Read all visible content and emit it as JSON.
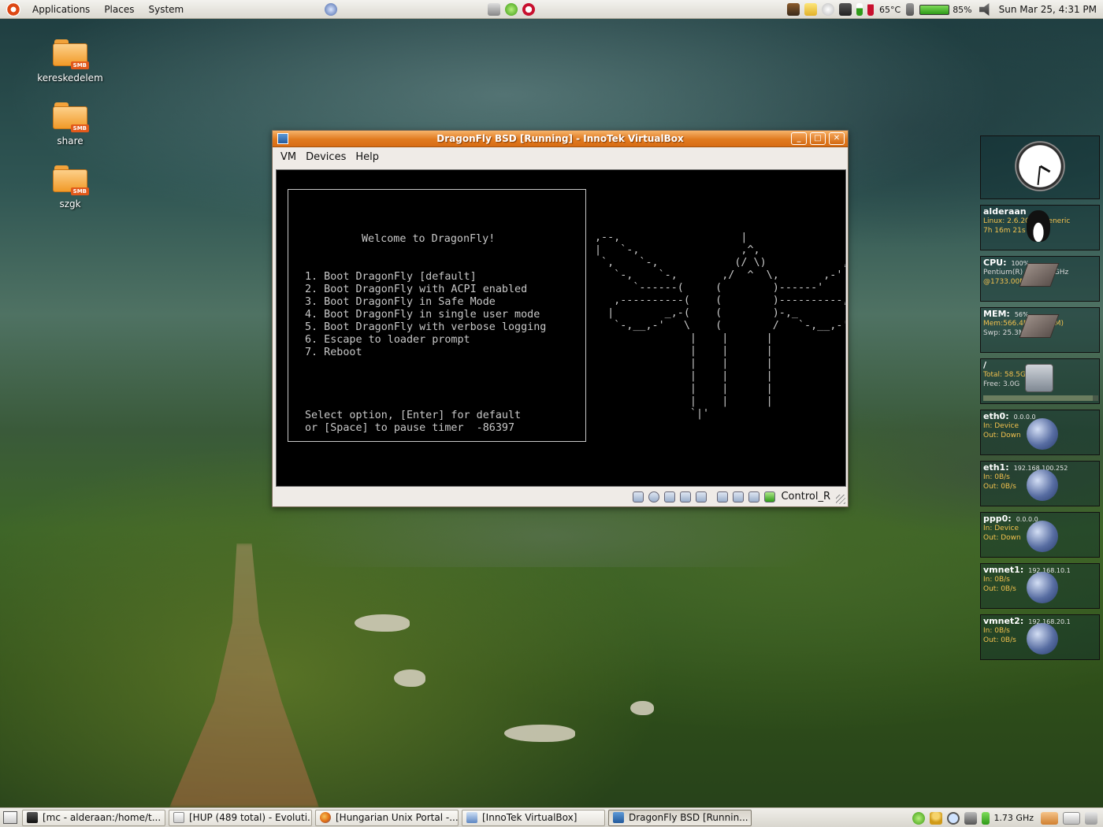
{
  "top_panel": {
    "menus": [
      "Applications",
      "Places",
      "System"
    ],
    "temperature": "65°C",
    "battery": "85%",
    "clock": "Sun Mar 25,  4:31 PM"
  },
  "desktop_icons": [
    {
      "label": "kereskedelem",
      "badge": "SMB"
    },
    {
      "label": "share",
      "badge": "SMB"
    },
    {
      "label": "szgk",
      "badge": "SMB"
    }
  ],
  "vbox": {
    "title": "DragonFly BSD [Running] - InnoTek VirtualBox",
    "menus": [
      "VM",
      "Devices",
      "Help"
    ],
    "host_key": "Control_R",
    "boot": {
      "welcome": "Welcome to DragonFly!",
      "options": [
        "1. Boot DragonFly [default]",
        "2. Boot DragonFly with ACPI enabled",
        "3. Boot DragonFly in Safe Mode",
        "4. Boot DragonFly in single user mode",
        "5. Boot DragonFly with verbose logging",
        "6. Escape to loader prompt",
        "7. Reboot"
      ],
      "prompt_line1": "Select option, [Enter] for default",
      "prompt_line2": "or [Space] to pause timer  -86397"
    },
    "ascii_art": ",--,                   |                   ,--,\n|   `-,                ,^,                ,-'   |\n `,    `-,            (/ \\)            ,-'    ,'\n   `-,    `-,       ,/  ^  \\,       ,-'    ,-'\n      `------(     (        )------'\n   ,----------(    (        )----------,\n  |        _,-(    (        )-,_        |\n   `-,__,-'   \\    (        /   `-,__,-'\n               |    |      |\n               |    |      |\n               |    |      |\n               |    |      |\n               |    |      |\n               |    |      |\n               `|'"
  },
  "widgets": {
    "host": {
      "name": "alderaan",
      "line1": "Linux: 2.6.20-12-generic",
      "line2": "7h 16m 21s"
    },
    "cpu": {
      "label": "CPU:",
      "value": "100%",
      "line1": "Pentium(R) M - 1.73GHz",
      "line2": "@1733.00Mhz"
    },
    "mem": {
      "label": "MEM:",
      "value": "56%",
      "line1": "Mem:566.4M (810.4M)",
      "line2": "Swp: 25.3M (1.7G)"
    },
    "fs": {
      "label": "/",
      "line1": "Total: 58.5G",
      "line2": "Free: 3.0G",
      "used_fraction": 0.95
    },
    "nets": [
      {
        "name": "eth0:",
        "ip": "0.0.0.0",
        "in": "In:   Device",
        "out": "Out: Down"
      },
      {
        "name": "eth1:",
        "ip": "192.168.100.252",
        "in": "In:   0B/s",
        "out": "Out: 0B/s"
      },
      {
        "name": "ppp0:",
        "ip": "0.0.0.0",
        "in": "In:   Device",
        "out": "Out: Down"
      },
      {
        "name": "vmnet1:",
        "ip": "192.168.10.1",
        "in": "In:   0B/s",
        "out": "Out: 0B/s"
      },
      {
        "name": "vmnet2:",
        "ip": "192.168.20.1",
        "in": "In:   0B/s",
        "out": "Out: 0B/s"
      }
    ]
  },
  "taskbar": {
    "tasks": [
      {
        "label": "[mc - alderaan:/home/t...",
        "active": false
      },
      {
        "label": "[HUP (489 total) - Evoluti...",
        "active": false
      },
      {
        "label": "[Hungarian Unix Portal -...",
        "active": false
      },
      {
        "label": "[InnoTek VirtualBox]",
        "active": false
      },
      {
        "label": "DragonFly BSD [Runnin...",
        "active": true
      }
    ],
    "cpu_freq": "1.73 GHz"
  }
}
